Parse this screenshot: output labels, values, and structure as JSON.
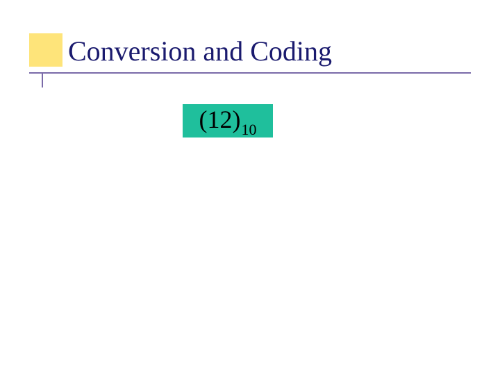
{
  "slide": {
    "title": "Conversion and Coding"
  },
  "formula": {
    "main": "(12)",
    "subscript": "10"
  },
  "colors": {
    "accent_yellow": "#fee47a",
    "title_color": "#1a1a6e",
    "line_color": "#7a6aa8",
    "highlight_box": "#1fbf9c"
  }
}
